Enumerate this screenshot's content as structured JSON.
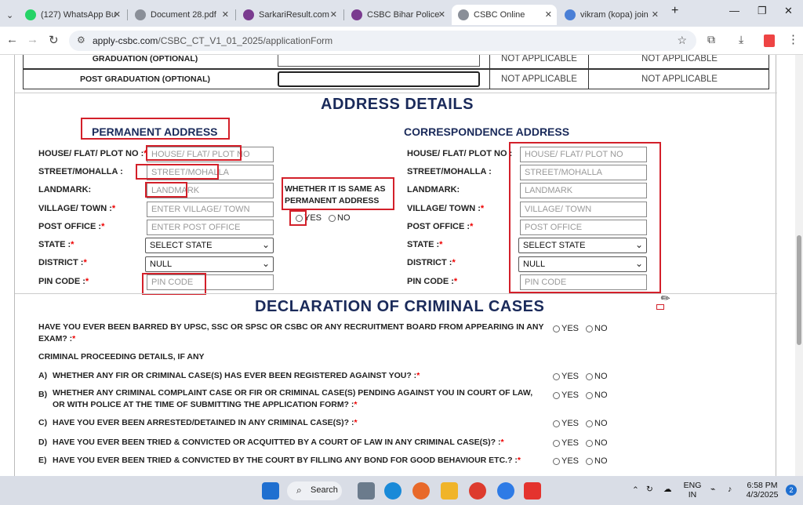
{
  "browser": {
    "tabs": [
      {
        "title": "(127) WhatsApp Bu",
        "color": "#25d366"
      },
      {
        "title": "Document 28.pdf",
        "color": "#8a8f98"
      },
      {
        "title": "SarkariResult.com",
        "color": "#7a3b8f"
      },
      {
        "title": "CSBC Bihar Police",
        "color": "#7a3b8f"
      },
      {
        "title": "CSBC Online",
        "color": "#8a8f98"
      },
      {
        "title": "vikram (kopa) join",
        "color": "#4a7fd6"
      }
    ],
    "url_domain": "apply-csbc.com",
    "url_path": "/CSBC_CT_V1_01_2025/applicationForm"
  },
  "education": {
    "rows": [
      {
        "label": "GRADUATION (OPTIONAL)",
        "c1": "NOT APPLICABLE",
        "c2": "NOT APPLICABLE"
      },
      {
        "label": "POST GRADUATION (OPTIONAL)",
        "c1": "NOT APPLICABLE",
        "c2": "NOT APPLICABLE"
      }
    ]
  },
  "address": {
    "title": "ADDRESS DETAILS",
    "permanent_title": "PERMANENT ADDRESS",
    "correspondence_title": "CORRESPONDENCE ADDRESS",
    "labels": {
      "house": "HOUSE/ FLAT/ PLOT NO :",
      "street": "STREET/MOHALLA :",
      "landmark": "LANDMARK:",
      "village": "VILLAGE/ TOWN :",
      "post": "POST OFFICE :",
      "state": "STATE :",
      "district": "DISTRICT :",
      "pin": "PIN CODE :"
    },
    "corr_labels": {
      "house": "HOUSE/ FLAT/ PLOT NO :",
      "street": "STREET/MOHALLA :",
      "landmark": "LANDMARK:",
      "village": "VILLAGE/ TOWN :",
      "post": "POST OFFICE :",
      "state": "STATE :",
      "district": "DISTRICT :",
      "pin": "PIN CODE :"
    },
    "permanent_placeholders": {
      "house": "HOUSE/ FLAT/ PLOT NO",
      "street": "STREET/MOHALLA",
      "landmark": "LANDMARK",
      "village": "ENTER VILLAGE/ TOWN",
      "post": "ENTER POST OFFICE",
      "state": "SELECT STATE",
      "district": "NULL",
      "pin": "PIN CODE"
    },
    "correspondence_placeholders": {
      "house": "HOUSE/ FLAT/ PLOT NO",
      "street": "STREET/MOHALLA",
      "landmark": "LANDMARK",
      "village": "VILLAGE/ TOWN",
      "post": "POST OFFICE",
      "state": "SELECT STATE",
      "district": "NULL",
      "pin": "PIN CODE"
    },
    "same_as_question": "WHETHER IT IS SAME AS PERMANENT ADDRESS",
    "yes": "YES",
    "no": "NO"
  },
  "criminal": {
    "title": "DECLARATION OF CRIMINAL CASES",
    "q0": "HAVE YOU EVER BEEN BARRED BY UPSC, SSC OR SPSC OR CSBC OR ANY RECRUITMENT BOARD FROM APPEARING IN ANY EXAM? :",
    "proceeding_heading": "CRIMINAL PROCEEDING DETAILS, IF ANY",
    "questions": [
      {
        "letter": "A)",
        "text": "WHETHER ANY FIR OR CRIMINAL CASE(S) HAS EVER BEEN REGISTERED AGAINST YOU? :"
      },
      {
        "letter": "B)",
        "text": "WHETHER ANY CRIMINAL COMPLAINT CASE OR FIR OR CRIMINAL CASE(S) PENDING AGAINST YOU IN COURT OF LAW, OR WITH POLICE AT THE TIME OF SUBMITTING THE APPLICATION FORM? :"
      },
      {
        "letter": "C)",
        "text": "HAVE YOU EVER BEEN ARRESTED/DETAINED IN ANY CRIMINAL CASE(S)? :"
      },
      {
        "letter": "D)",
        "text": "HAVE YOU EVER BEEN TRIED & CONVICTED OR ACQUITTED BY A COURT OF LAW IN ANY CRIMINAL CASE(S)? :"
      },
      {
        "letter": "E)",
        "text": "HAVE YOU EVER BEEN TRIED & CONVICTED BY THE COURT BY FILLING ANY BOND FOR GOOD BEHAVIOUR ETC.? :"
      }
    ],
    "yes": "YES",
    "no": "NO"
  },
  "taskbar": {
    "search": "Search",
    "lang1": "ENG",
    "lang2": "IN",
    "time": "6:58 PM",
    "date": "4/3/2025",
    "notif": "2"
  }
}
